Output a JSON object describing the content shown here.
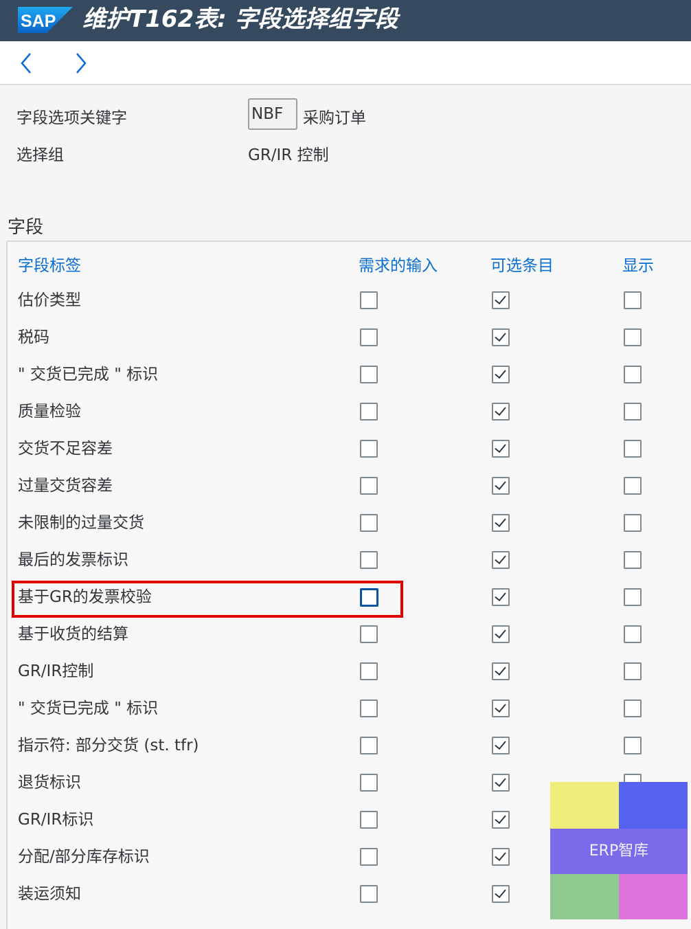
{
  "app": {
    "logo_text": "SAP",
    "title": "维护T162表: 字段选择组字段",
    "brand_color": "#354a5f"
  },
  "nav": {
    "back_icon": "chevron-left-icon",
    "forward_icon": "chevron-right-icon"
  },
  "header_fields": {
    "key_label": "字段选项关键字",
    "key_value": "NBF",
    "key_desc": "采购订单",
    "group_label": "选择组",
    "group_value": "GR/IR 控制"
  },
  "section_title": "字段",
  "table": {
    "columns": [
      "字段标签",
      "需求的输入",
      "可选条目",
      "显示"
    ],
    "rows": [
      {
        "label": "估价类型",
        "required": false,
        "optional": true,
        "display": false
      },
      {
        "label": "税码",
        "required": false,
        "optional": true,
        "display": false
      },
      {
        "label": "\" 交货已完成 \" 标识",
        "required": false,
        "optional": true,
        "display": false
      },
      {
        "label": "质量检验",
        "required": false,
        "optional": true,
        "display": false
      },
      {
        "label": "交货不足容差",
        "required": false,
        "optional": true,
        "display": false
      },
      {
        "label": "过量交货容差",
        "required": false,
        "optional": true,
        "display": false
      },
      {
        "label": "未限制的过量交货",
        "required": false,
        "optional": true,
        "display": false
      },
      {
        "label": "最后的发票标识",
        "required": false,
        "optional": true,
        "display": false
      },
      {
        "label": "基于GR的发票校验",
        "required": false,
        "optional": true,
        "display": false,
        "highlighted": true
      },
      {
        "label": "基于收货的结算",
        "required": false,
        "optional": true,
        "display": false
      },
      {
        "label": "GR/IR控制",
        "required": false,
        "optional": true,
        "display": false
      },
      {
        "label": "\" 交货已完成 \" 标识",
        "required": false,
        "optional": true,
        "display": false
      },
      {
        "label": "指示符: 部分交货 (st. tfr)",
        "required": false,
        "optional": true,
        "display": false
      },
      {
        "label": "退货标识",
        "required": false,
        "optional": true,
        "display": false
      },
      {
        "label": "GR/IR标识",
        "required": false,
        "optional": true,
        "display": false
      },
      {
        "label": "分配/部分库存标识",
        "required": false,
        "optional": true,
        "display": false
      },
      {
        "label": "装运须知",
        "required": false,
        "optional": true,
        "display": false
      }
    ]
  },
  "watermark": {
    "text": "ERP智库"
  },
  "colors": {
    "link": "#0a6ed1",
    "highlight_border": "#e00000"
  }
}
